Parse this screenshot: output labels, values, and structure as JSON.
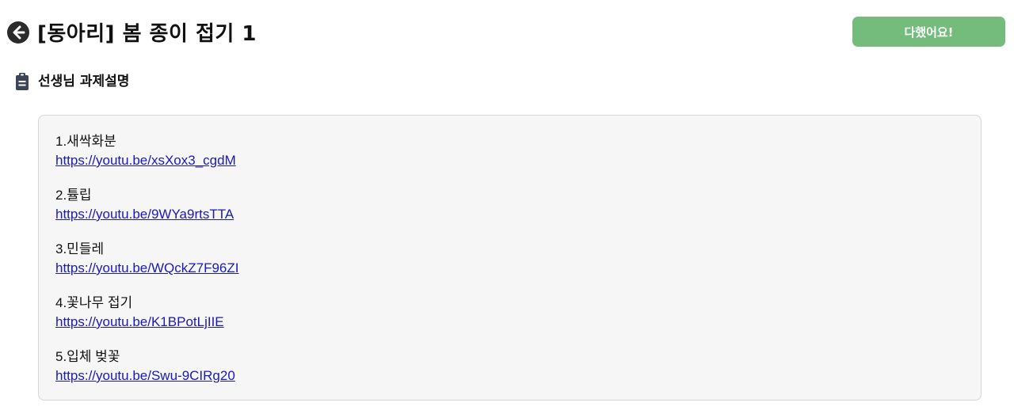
{
  "header": {
    "title": "[동아리] 봄 종이 접기 1",
    "done_button_label": "다했어요!"
  },
  "section": {
    "title": "선생님 과제설명"
  },
  "items": [
    {
      "label": "1.새싹화분",
      "link": "https://youtu.be/xsXox3_cgdM"
    },
    {
      "label": "2.튤립",
      "link": "https://youtu.be/9WYa9rtsTTA"
    },
    {
      "label": "3.민들레",
      "link": "https://youtu.be/WQckZ7F96ZI"
    },
    {
      "label": "4.꽃나무 접기",
      "link": "https://youtu.be/K1BPotLjIIE"
    },
    {
      "label": "5.입체 벚꽃",
      "link": "https://youtu.be/Swu-9CIRg20"
    }
  ],
  "icons": {
    "back": "back-arrow-icon",
    "clipboard": "clipboard-icon"
  },
  "colors": {
    "done_button": "#74bc7b",
    "link": "#1a1ab8",
    "box_background": "#f6f6f6"
  }
}
